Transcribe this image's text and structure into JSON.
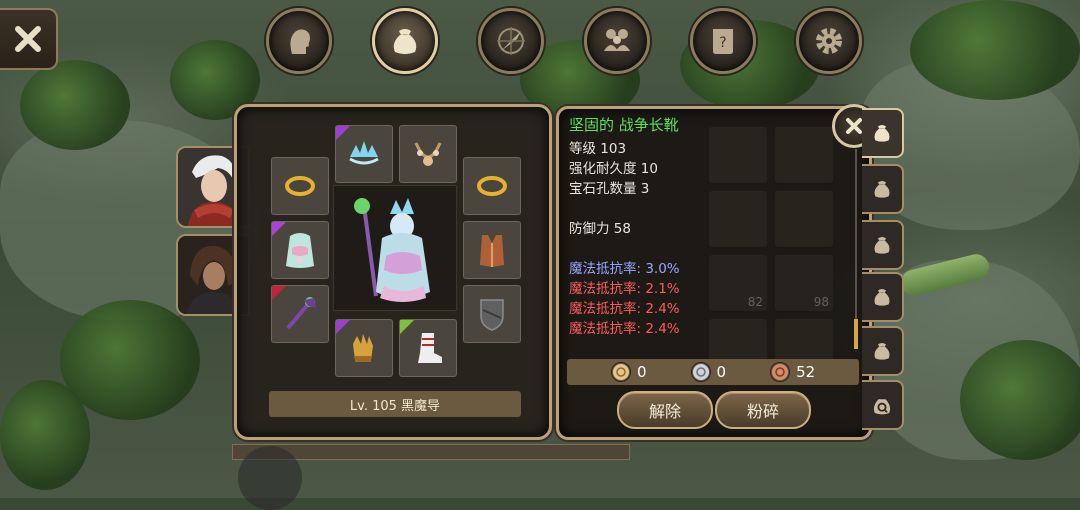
{
  "nav": {
    "tabs": [
      {
        "name": "character",
        "icon": "head-icon"
      },
      {
        "name": "inventory",
        "icon": "bag-icon",
        "active": true
      },
      {
        "name": "skills",
        "icon": "compass-blade-icon"
      },
      {
        "name": "party",
        "icon": "people-icon"
      },
      {
        "name": "quests",
        "icon": "scroll-icon"
      },
      {
        "name": "settings",
        "icon": "gear-icon"
      }
    ]
  },
  "equipment": {
    "level_label": "Lv. 105 黑魔导",
    "slots": [
      {
        "name": "necklace",
        "icon": "tiara-icon",
        "rarity": "#9a3fd0"
      },
      {
        "name": "amulet",
        "icon": "necklace-icon",
        "rarity": ""
      },
      {
        "name": "ring-left",
        "icon": "ring-icon",
        "rarity": ""
      },
      {
        "name": "ring-right",
        "icon": "ring-icon",
        "rarity": ""
      },
      {
        "name": "armor",
        "icon": "robe-icon",
        "rarity": "#b041d8"
      },
      {
        "name": "cape",
        "icon": "vest-icon",
        "rarity": ""
      },
      {
        "name": "weapon",
        "icon": "staff-icon",
        "rarity": "#c0243a"
      },
      {
        "name": "shield",
        "icon": "shield-icon",
        "rarity": ""
      },
      {
        "name": "gloves",
        "icon": "gloves-icon",
        "rarity": "#9a3fd0"
      },
      {
        "name": "boots",
        "icon": "boots-icon",
        "rarity": "#7ec23a"
      }
    ]
  },
  "tooltip": {
    "title": "坚固的 战争长靴",
    "lines": [
      {
        "text": "等级 103",
        "tone": "normal"
      },
      {
        "text": "强化耐久度 10",
        "tone": "normal"
      },
      {
        "text": "宝石孔数量 3",
        "tone": "normal"
      },
      {
        "text": "",
        "tone": "spacer"
      },
      {
        "text": "防御力 58",
        "tone": "normal"
      },
      {
        "text": "",
        "tone": "spacer"
      },
      {
        "text": "魔法抵抗率: 3.0%",
        "tone": "blue"
      },
      {
        "text": "魔法抵抗率: 2.1%",
        "tone": "red"
      },
      {
        "text": "魔法抵抗率: 2.4%",
        "tone": "red"
      },
      {
        "text": "魔法抵抗率: 2.4%",
        "tone": "red"
      }
    ]
  },
  "currency": {
    "gold": "0",
    "silver": "0",
    "bronze": "52"
  },
  "actions": {
    "unequip": "解除",
    "shatter": "粉碎"
  },
  "inventory_tabs": [
    {
      "name": "bag-1",
      "active": true
    },
    {
      "name": "bag-2",
      "active": false
    },
    {
      "name": "bag-3",
      "active": false
    },
    {
      "name": "bag-4",
      "active": false
    },
    {
      "name": "bag-5",
      "active": false
    },
    {
      "name": "search",
      "active": false
    }
  ],
  "ghost_counts": [
    "82",
    "98"
  ],
  "colors": {
    "accent_border": "#b9a27a",
    "title_green": "#5fe05a",
    "stat_blue": "#9aa5ff",
    "stat_red": "#ff5a5a"
  }
}
